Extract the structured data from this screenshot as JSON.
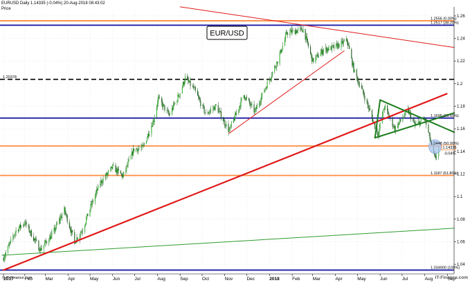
{
  "header": {
    "symbol_line": "EURUSD   Daily   1.14335 (-0.04%)   20-Aug-2018 08:43:02",
    "price_label": "Price",
    "title": "EUR/USD",
    "watermark": "© IT-Finance.com",
    "brand": "IT-Finance.com"
  },
  "chart_data": {
    "type": "candlestick",
    "title": "EUR/USD",
    "xlabel": "",
    "ylabel": "",
    "ylim": [
      1.0315,
      1.263
    ],
    "x_range": [
      "2017-01-01",
      "2018-09-10"
    ],
    "x_ticks": [
      {
        "date": "2017-01-03",
        "label": "2017",
        "bold": true
      },
      {
        "date": "2017-02-01",
        "label": "Feb"
      },
      {
        "date": "2017-03-01",
        "label": "Mar"
      },
      {
        "date": "2017-04-01",
        "label": "Apr"
      },
      {
        "date": "2017-05-01",
        "label": "May"
      },
      {
        "date": "2017-06-01",
        "label": "Jun"
      },
      {
        "date": "2017-07-01",
        "label": "Jul"
      },
      {
        "date": "2017-08-01",
        "label": "Aug"
      },
      {
        "date": "2017-09-01",
        "label": "Sep"
      },
      {
        "date": "2017-10-01",
        "label": "Oct"
      },
      {
        "date": "2017-11-01",
        "label": "Nov"
      },
      {
        "date": "2017-12-01",
        "label": "Dec"
      },
      {
        "date": "2018-01-01",
        "label": "2018",
        "bold": true
      },
      {
        "date": "2018-02-01",
        "label": "Feb"
      },
      {
        "date": "2018-03-01",
        "label": "Mar"
      },
      {
        "date": "2018-04-01",
        "label": "Apr"
      },
      {
        "date": "2018-05-01",
        "label": "May"
      },
      {
        "date": "2018-06-01",
        "label": "Jun"
      },
      {
        "date": "2018-07-01",
        "label": "Jul"
      },
      {
        "date": "2018-08-01",
        "label": "Aug"
      },
      {
        "date": "2018-09-01",
        "label": "Sep"
      }
    ],
    "y_ticks": [
      {
        "value": 1.26,
        "label": "1.26"
      },
      {
        "value": 1.24,
        "label": "1.24"
      },
      {
        "value": 1.22,
        "label": "1.22"
      },
      {
        "value": 1.2,
        "label": "1.2"
      },
      {
        "value": 1.18,
        "label": "1.18"
      },
      {
        "value": 1.16,
        "label": "1.16"
      },
      {
        "value": 1.14,
        "label": "1.14"
      },
      {
        "value": 1.12,
        "label": "1.12"
      },
      {
        "value": 1.1,
        "label": "1.1"
      },
      {
        "value": 1.08,
        "label": "1.08"
      },
      {
        "value": 1.06,
        "label": "1.06"
      },
      {
        "value": 1.04,
        "label": "1.04"
      }
    ],
    "last_price": {
      "value": 1.14335,
      "label": "1.14335",
      "change": "-0.04%"
    },
    "levels": [
      {
        "value": 1.2556,
        "label": "1.2556 (0.00%)",
        "color": "#ff8c42",
        "style": "solid"
      },
      {
        "value": 1.2517,
        "label": "1.2517 (38.20%)",
        "color": "#1a1aa6",
        "style": "solid"
      },
      {
        "value": 1.20378,
        "label": "1.20378",
        "color": "#000000",
        "style": "dashed"
      },
      {
        "value": 1.1695,
        "label": "1.1695 (23.60%)",
        "color": "#1a1aa6",
        "style": "solid"
      },
      {
        "value": 1.1448,
        "label": "1.1448 (50.00%)",
        "color": "#ff8c42",
        "style": "solid"
      },
      {
        "value": 1.1187,
        "label": "1.1187 (61.80%)",
        "color": "#ff8c42",
        "style": "solid"
      },
      {
        "value": 1.0349,
        "label": "1.034900 (100%)",
        "color": "#1a1aa6",
        "style": "solid"
      }
    ],
    "trendlines": [
      {
        "name": "long-term-uptrend",
        "color": "#e01818",
        "width": 2.2,
        "points": [
          [
            "2017-01-03",
            1.0349
          ],
          [
            "2018-08-31",
            1.191
          ]
        ]
      },
      {
        "name": "rising-channel",
        "color": "#e01818",
        "width": 1.0,
        "points": [
          [
            "2017-11-07",
            1.156
          ],
          [
            "2018-04-13",
            1.229
          ]
        ]
      },
      {
        "name": "falling-resistance",
        "color": "#e01818",
        "width": 1.0,
        "points": [
          [
            "2017-09-01",
            1.268
          ],
          [
            "2018-09-10",
            1.232
          ]
        ]
      },
      {
        "name": "green-long-term",
        "color": "#2e9b2e",
        "width": 1.0,
        "points": [
          [
            "2017-01-01",
            1.048
          ],
          [
            "2018-09-10",
            1.072
          ]
        ]
      },
      {
        "name": "triangle-upper",
        "color": "#1e7d1e",
        "width": 2.0,
        "points": [
          [
            "2018-06-01",
            1.1855
          ],
          [
            "2018-09-10",
            1.157
          ]
        ]
      },
      {
        "name": "triangle-lower",
        "color": "#1e7d1e",
        "width": 2.0,
        "points": [
          [
            "2018-05-25",
            1.152
          ],
          [
            "2018-09-10",
            1.174
          ]
        ]
      },
      {
        "name": "triangle-left-edge",
        "color": "#1e7d1e",
        "width": 2.0,
        "points": [
          [
            "2018-05-25",
            1.152
          ],
          [
            "2018-06-01",
            1.1855
          ]
        ]
      }
    ],
    "highlight": {
      "date": "2018-08-15",
      "value": 1.1442
    },
    "anchors": [
      [
        "2017-01-03",
        1.046
      ],
      [
        "2017-01-20",
        1.07
      ],
      [
        "2017-02-01",
        1.077
      ],
      [
        "2017-02-22",
        1.053
      ],
      [
        "2017-03-10",
        1.066
      ],
      [
        "2017-03-27",
        1.088
      ],
      [
        "2017-04-10",
        1.06
      ],
      [
        "2017-04-21",
        1.071
      ],
      [
        "2017-05-03",
        1.093
      ],
      [
        "2017-05-15",
        1.112
      ],
      [
        "2017-06-01",
        1.126
      ],
      [
        "2017-06-15",
        1.118
      ],
      [
        "2017-06-30",
        1.142
      ],
      [
        "2017-07-12",
        1.143
      ],
      [
        "2017-07-27",
        1.168
      ],
      [
        "2017-08-02",
        1.187
      ],
      [
        "2017-08-17",
        1.172
      ],
      [
        "2017-09-01",
        1.192
      ],
      [
        "2017-09-08",
        1.205
      ],
      [
        "2017-09-21",
        1.194
      ],
      [
        "2017-10-06",
        1.173
      ],
      [
        "2017-10-20",
        1.18
      ],
      [
        "2017-11-07",
        1.158
      ],
      [
        "2017-11-27",
        1.19
      ],
      [
        "2017-12-12",
        1.175
      ],
      [
        "2017-12-29",
        1.2
      ],
      [
        "2018-01-12",
        1.22
      ],
      [
        "2018-01-25",
        1.245
      ],
      [
        "2018-02-16",
        1.248
      ],
      [
        "2018-03-01",
        1.22
      ],
      [
        "2018-03-16",
        1.23
      ],
      [
        "2018-03-30",
        1.232
      ],
      [
        "2018-04-17",
        1.238
      ],
      [
        "2018-04-27",
        1.21
      ],
      [
        "2018-05-10",
        1.19
      ],
      [
        "2018-05-29",
        1.155
      ],
      [
        "2018-06-07",
        1.18
      ],
      [
        "2018-06-21",
        1.16
      ],
      [
        "2018-07-09",
        1.176
      ],
      [
        "2018-07-19",
        1.163
      ],
      [
        "2018-08-01",
        1.169
      ],
      [
        "2018-08-15",
        1.133
      ],
      [
        "2018-08-20",
        1.1433
      ]
    ]
  }
}
